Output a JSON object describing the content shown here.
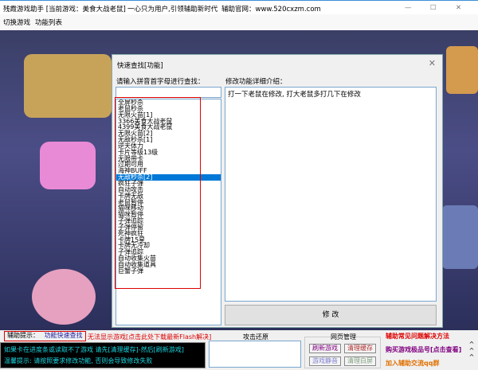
{
  "window": {
    "title": "残霞游戏助手 [当前游戏：美食大战老鼠]",
    "slogan": "一心只为用户,引领辅助新时代",
    "site": "辅助官网：www.520cxzm.com",
    "minimize": "—",
    "maximize": "☐",
    "close": "✕"
  },
  "menu": [
    "切换游戏",
    "功能列表"
  ],
  "dialog": {
    "title": "快速查找[功能]",
    "close": "✕",
    "search_label": "请输入拼音首字母进行查找：",
    "search_value": "",
    "desc_label": "修改功能详细介绍：",
    "desc_text": "打一下老鼠在修改, 打大老鼠多打几下在修改",
    "modify_button": "修 改",
    "items": [
      "全屏秒杀",
      "老鼠秒杀",
      "无限火苗[1]",
      "3366美食大战老鼠",
      "4399美食大战老鼠",
      "无限火苗[2]",
      "无敌秒杀[1]",
      "逆天体力",
      "卡片等级13级",
      "无限带卡",
      "过期可用",
      "海神BUFF",
      "无敌秒杀[2]",
      "疯狂子弹",
      "自动攻击",
      "卡牌无敌",
      "老鼠暂停",
      "猫咪移动",
      "猫咪暂停",
      "子弹追踪",
      "子弹停留",
      "死神疯狂",
      "卡牌15星",
      "卡牌无冷却",
      "子弹追踪",
      "自动收集火苗",
      "自动收集道具",
      "巨蟹子弹"
    ],
    "selected_index": 12
  },
  "bottom": {
    "tip_label": "辅助提示：",
    "tip_link": "功能快速查找",
    "flash_warning": "无法显示游戏[点击此处下载最新Flash解决]",
    "console_lines": [
      "如果卡在进度条或读取不了游戏 请先[清理缓存]-然后[刷新游戏]",
      "温馨提示: 请按照要求修改功能, 否则会导致修改失败"
    ],
    "restore_label": "攻击还原",
    "web_group": "网页管理",
    "buttons": [
      "刷新游戏",
      "清理缓存",
      "游戏静音",
      "清理白屏"
    ],
    "links": [
      "辅助常见问题解决方法",
      "购买游戏极品号[点击查看]",
      "加入辅助交流qq群"
    ],
    "scroll": "^\n^\n^"
  },
  "colors": {
    "accent": "#0078d7",
    "warning": "#d00000",
    "console_text": "#19d6e0"
  }
}
